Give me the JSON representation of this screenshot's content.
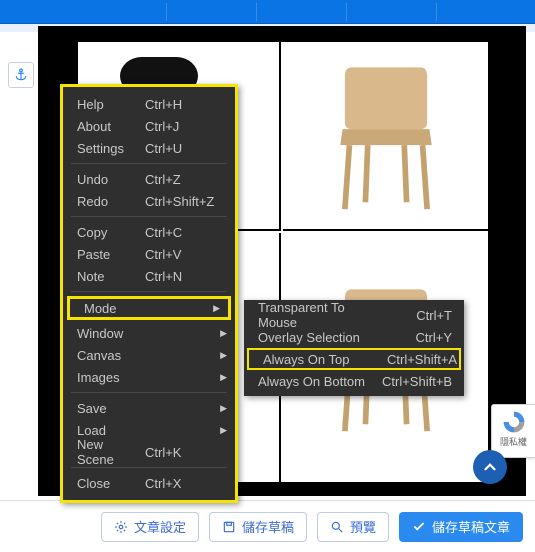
{
  "topbar": {},
  "anchor": {
    "name": "anchor-icon"
  },
  "menu_main": {
    "groups": [
      [
        {
          "label": "Help",
          "shortcut": "Ctrl+H"
        },
        {
          "label": "About",
          "shortcut": "Ctrl+J"
        },
        {
          "label": "Settings",
          "shortcut": "Ctrl+U"
        }
      ],
      [
        {
          "label": "Undo",
          "shortcut": "Ctrl+Z"
        },
        {
          "label": "Redo",
          "shortcut": "Ctrl+Shift+Z"
        }
      ],
      [
        {
          "label": "Copy",
          "shortcut": "Ctrl+C"
        },
        {
          "label": "Paste",
          "shortcut": "Ctrl+V"
        },
        {
          "label": "Note",
          "shortcut": "Ctrl+N"
        }
      ],
      [
        {
          "label": "Mode",
          "shortcut": "",
          "submenu": true,
          "highlight": true
        },
        {
          "label": "Window",
          "shortcut": "",
          "submenu": true
        },
        {
          "label": "Canvas",
          "shortcut": "",
          "submenu": true
        },
        {
          "label": "Images",
          "shortcut": "",
          "submenu": true
        }
      ],
      [
        {
          "label": "Save",
          "shortcut": "",
          "submenu": true
        },
        {
          "label": "Load",
          "shortcut": "",
          "submenu": true
        },
        {
          "label": "New Scene",
          "shortcut": "Ctrl+K"
        }
      ],
      [
        {
          "label": "Close",
          "shortcut": "Ctrl+X"
        }
      ]
    ]
  },
  "submenu_mode": {
    "items": [
      {
        "label": "Transparent To Mouse",
        "shortcut": "Ctrl+T"
      },
      {
        "label": "Overlay Selection",
        "shortcut": "Ctrl+Y"
      },
      {
        "label": "Always On Top",
        "shortcut": "Ctrl+Shift+A",
        "highlight": true
      },
      {
        "label": "Always On Bottom",
        "shortcut": "Ctrl+Shift+B"
      }
    ]
  },
  "bottom": {
    "article_settings": "文章設定",
    "save_draft": "儲存草稿",
    "preview": "預覽",
    "save_draft_article": "儲存草稿文章"
  },
  "recaptcha": {
    "label": "隱私權"
  }
}
